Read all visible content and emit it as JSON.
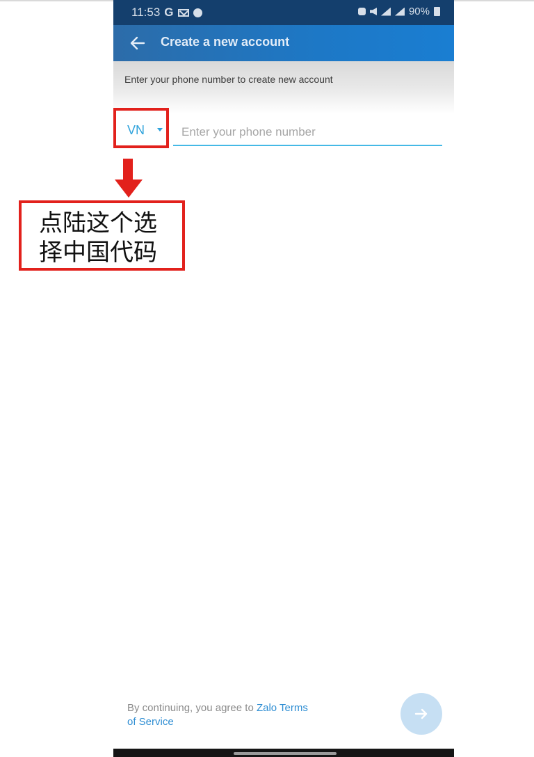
{
  "status_bar": {
    "time": "11:53",
    "google_icon": "G",
    "battery_level": "90%"
  },
  "app_bar": {
    "title": "Create a new account"
  },
  "subheader": {
    "text": "Enter your phone number to create new account"
  },
  "phone_form": {
    "country_code": "VN",
    "phone_placeholder": "Enter your phone number",
    "phone_value": ""
  },
  "footer": {
    "terms_prefix": "By continuing, you agree to ",
    "terms_link_part1": "Zalo Terms",
    "terms_link_part2": "of Service"
  },
  "annotation": {
    "note_line1": "点陆这个选",
    "note_line2": "择中国代码"
  },
  "colors": {
    "accent": "#2fa3dc",
    "annotation_red": "#e2211c",
    "app_bar": "#1d78c6",
    "status_bar": "#143f6d"
  },
  "icons": [
    "back-arrow-icon",
    "dropdown-icon",
    "next-arrow-icon",
    "annotation-arrow-icon"
  ]
}
